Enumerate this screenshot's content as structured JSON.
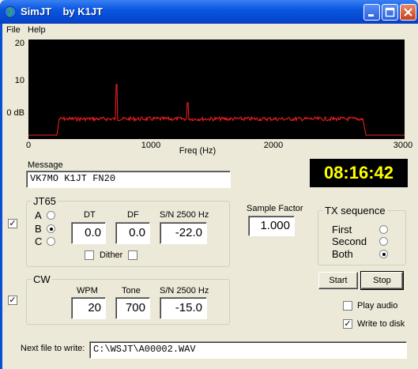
{
  "window": {
    "title": "SimJT    by K1JT"
  },
  "menu": {
    "file": "File",
    "help": "Help"
  },
  "spectrum": {
    "y_labels": [
      "20",
      "10",
      "0 dB"
    ],
    "x_labels": [
      "0",
      "1000",
      "2000",
      "3000"
    ],
    "x_title": "Freq (Hz)",
    "trace_color": "#ff2020",
    "background": "#000000"
  },
  "message": {
    "label": "Message",
    "value": "VK7MO K1JT FN20"
  },
  "clock": "08:16:42",
  "jt65": {
    "title": "JT65",
    "enabled": true,
    "modes": [
      {
        "label": "A",
        "selected": false
      },
      {
        "label": "B",
        "selected": true
      },
      {
        "label": "C",
        "selected": false
      }
    ],
    "dt_label": "DT",
    "dt_value": "0.0",
    "df_label": "DF",
    "df_value": "0.0",
    "sn_label": "S/N 2500 Hz",
    "sn_value": "-22.0",
    "dither_label": "Dither"
  },
  "sample_factor": {
    "label": "Sample Factor",
    "value": "1.000"
  },
  "tx_sequence": {
    "title": "TX sequence",
    "options": [
      {
        "label": "First",
        "selected": false
      },
      {
        "label": "Second",
        "selected": false
      },
      {
        "label": "Both",
        "selected": true
      }
    ]
  },
  "cw": {
    "title": "CW",
    "enabled": true,
    "wpm_label": "WPM",
    "wpm_value": "20",
    "tone_label": "Tone",
    "tone_value": "700",
    "sn_label": "S/N 2500 Hz",
    "sn_value": "-15.0"
  },
  "buttons": {
    "start": "Start",
    "stop": "Stop"
  },
  "options": {
    "play_audio": "Play audio",
    "play_audio_checked": false,
    "write_to_disk": "Write to disk",
    "write_to_disk_checked": true
  },
  "next_file": {
    "label": "Next file to write:",
    "value": "C:\\WSJT\\A00002.WAV"
  }
}
